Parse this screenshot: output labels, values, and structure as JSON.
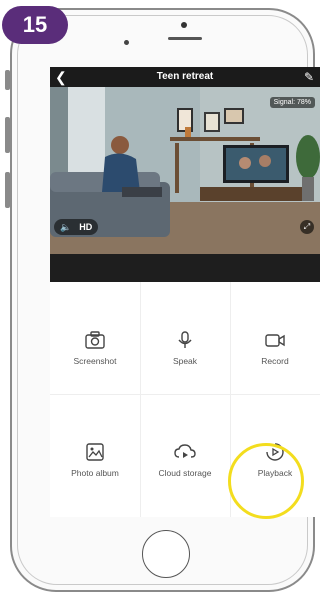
{
  "step_badge": "15",
  "header": {
    "title": "Teen retreat",
    "back_icon": "chevron-left-icon",
    "edit_icon": "pencil-icon"
  },
  "video": {
    "signal_text": "Signal: 78%",
    "quality_label": "HD",
    "volume_icon": "speaker-icon",
    "fullscreen_icon": "fullscreen-icon"
  },
  "actions": [
    {
      "label": "Screenshot",
      "icon": "camera-icon"
    },
    {
      "label": "Speak",
      "icon": "microphone-icon"
    },
    {
      "label": "Record",
      "icon": "video-camera-icon"
    },
    {
      "label": "Photo album",
      "icon": "image-icon"
    },
    {
      "label": "Cloud storage",
      "icon": "cloud-play-icon"
    },
    {
      "label": "Playback",
      "icon": "playback-icon"
    }
  ],
  "colors": {
    "badge": "#5a2d7a",
    "highlight_ring": "#f3dd1e",
    "header_bg": "#1b1b1b"
  }
}
